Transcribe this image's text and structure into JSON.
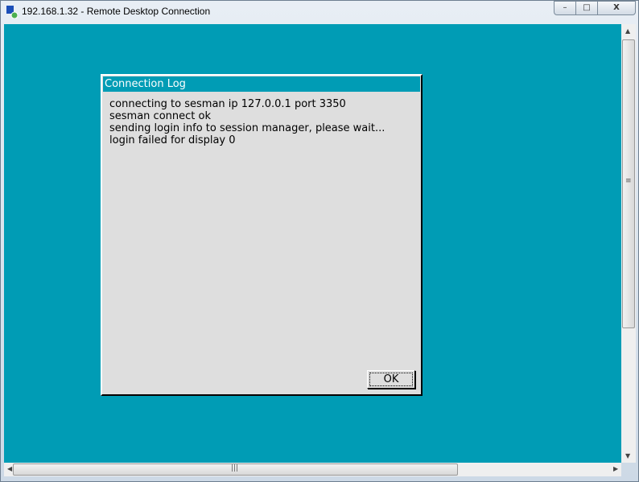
{
  "window": {
    "title": "192.168.1.32 - Remote Desktop Connection",
    "minimize": "–",
    "maximize": "□",
    "close": "X"
  },
  "dialog": {
    "title": "Connection Log",
    "log_lines": [
      "connecting to sesman ip 127.0.0.1 port 3350",
      "sesman connect ok",
      "sending login info to session manager, please wait...",
      "login failed for display 0"
    ],
    "ok_label": "OK"
  },
  "colors": {
    "desktop": "#009cb5",
    "dialog_bg": "#dedede"
  }
}
